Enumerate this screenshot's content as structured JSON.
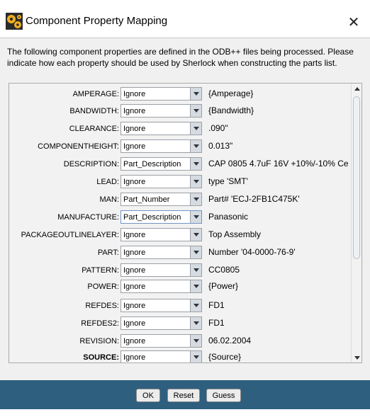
{
  "window": {
    "title": "Component Property Mapping",
    "close_glyph": "✕"
  },
  "intro_text": "The following component properties are defined in the ODB++ files being processed. Please indicate how each property should be used by Sherlock when constructing the parts list.",
  "rows": [
    {
      "label": "AMPERAGE:",
      "value": "Ignore",
      "text": "{Amperage}",
      "bold": false,
      "focus": false
    },
    {
      "label": "BANDWIDTH:",
      "value": "Ignore",
      "text": "{Bandwidth}",
      "bold": false,
      "focus": false
    },
    {
      "label": "CLEARANCE:",
      "value": "Ignore",
      "text": ".090\"",
      "bold": false,
      "focus": false
    },
    {
      "label": "COMPONENTHEIGHT:",
      "value": "Ignore",
      "text": "0.013\"",
      "bold": false,
      "focus": false
    },
    {
      "label": "DESCRIPTION:",
      "value": "Part_Description",
      "text": "CAP 0805 4.7uF 16V +10%/-10% Ce",
      "bold": false,
      "focus": false
    },
    {
      "label": "LEAD:",
      "value": "Ignore",
      "text": "type 'SMT'",
      "bold": false,
      "focus": false
    },
    {
      "label": "MAN:",
      "value": "Part_Number",
      "text": "Part# 'ECJ-2FB1C475K'",
      "bold": false,
      "focus": false
    },
    {
      "label": "MANUFACTURE:",
      "value": "Part_Description",
      "text": "Panasonic",
      "bold": false,
      "focus": true
    },
    {
      "label": "PACKAGEOUTLINELAYER:",
      "value": "Ignore",
      "text": "Top Assembly",
      "bold": false,
      "focus": false
    },
    {
      "label": "PART:",
      "value": "Ignore",
      "text": "Number '04-0000-76-9'",
      "bold": false,
      "focus": false
    },
    {
      "label": "PATTERN:",
      "value": "Ignore",
      "text": "CC0805",
      "bold": false,
      "focus": false
    },
    {
      "label": "POWER:",
      "value": "Ignore",
      "text": "{Power}",
      "bold": false,
      "focus": false
    },
    {
      "label": "REFDES:",
      "value": "Ignore",
      "text": "FD1",
      "bold": false,
      "focus": false
    },
    {
      "label": "REFDES2:",
      "value": "Ignore",
      "text": "FD1",
      "bold": false,
      "focus": false
    },
    {
      "label": "REVISION:",
      "value": "Ignore",
      "text": "06.02.2004",
      "bold": false,
      "focus": false
    },
    {
      "label": "SOURCE:",
      "value": "Ignore",
      "text": "{Source}",
      "bold": true,
      "focus": false
    }
  ],
  "buttons": {
    "ok": "OK",
    "reset": "Reset",
    "guess": "Guess"
  },
  "icons": {
    "app": "settings-gears-icon",
    "scroll_up": "scroll-up-arrow-icon",
    "scroll_down": "scroll-down-arrow-icon"
  },
  "colors": {
    "footer": "#2f5f7f",
    "panel_bg": "#f0f0f0",
    "focus_border": "#6f94c8"
  }
}
